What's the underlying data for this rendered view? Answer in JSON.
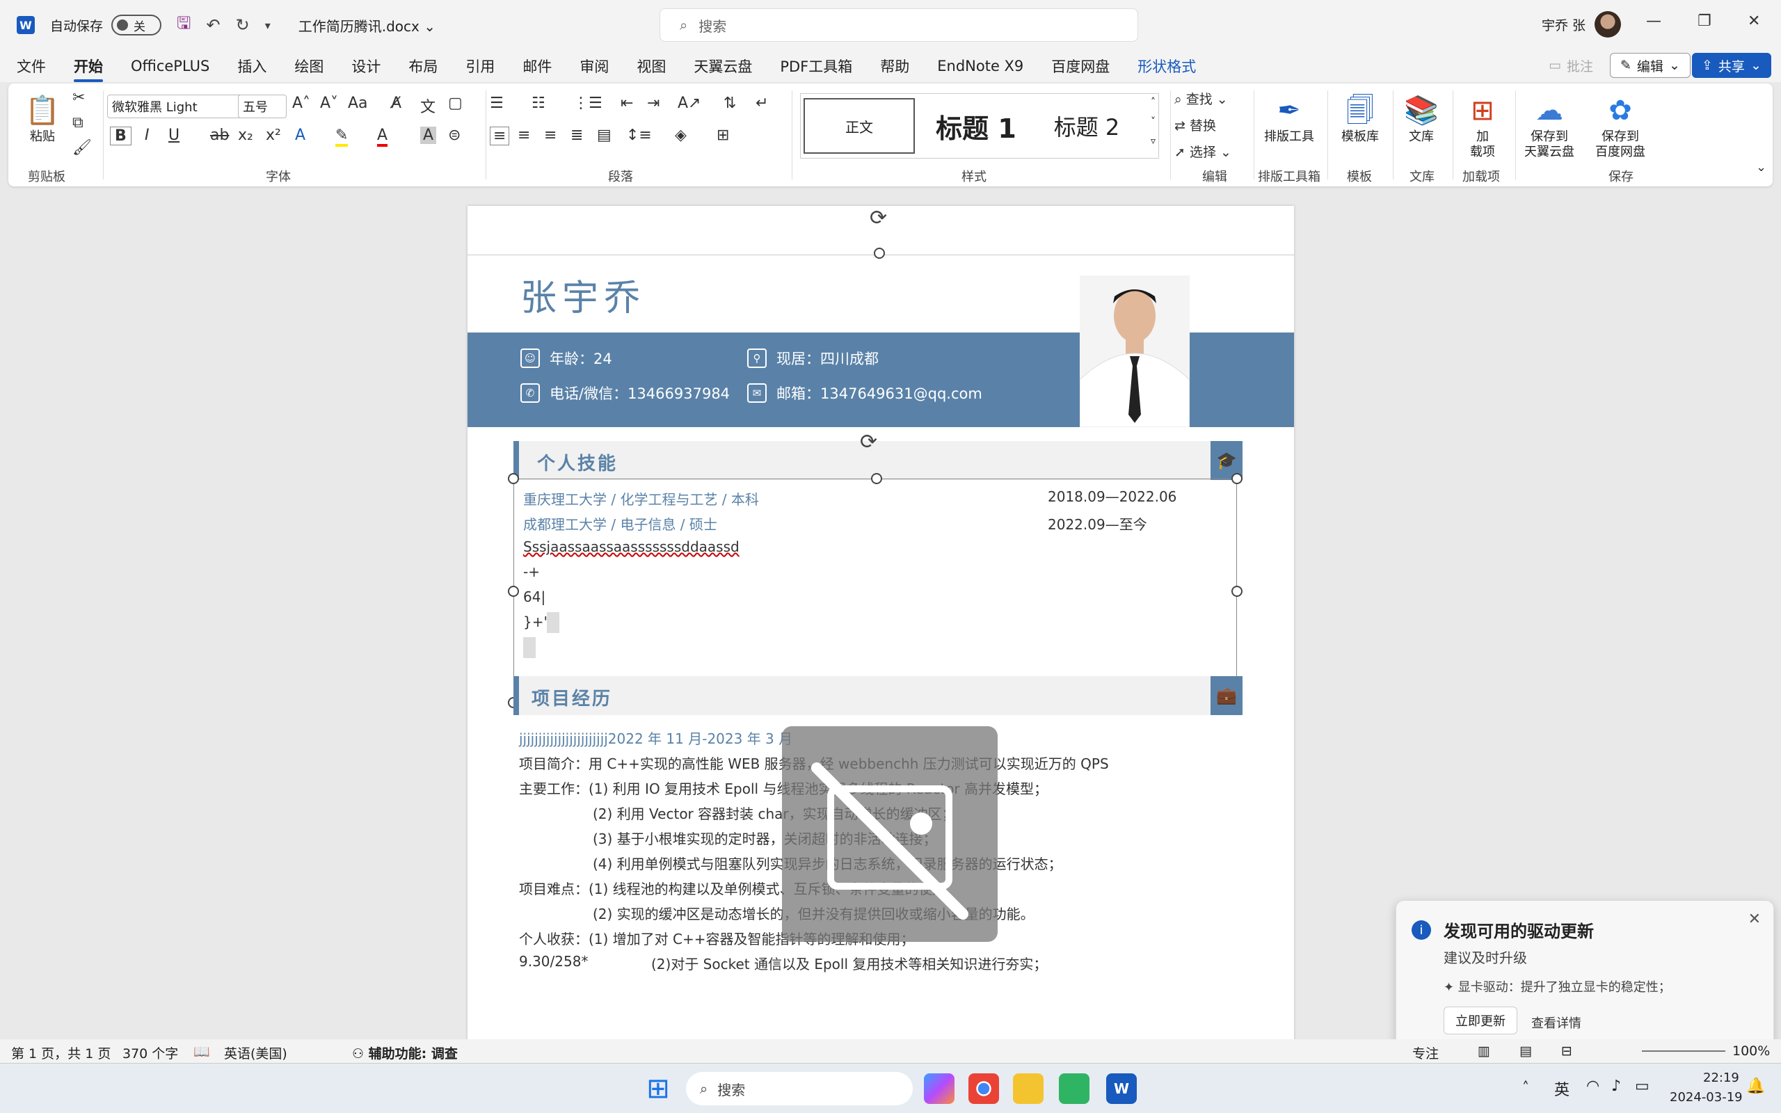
{
  "titlebar": {
    "autosave_label": "自动保存",
    "toggle_state": "关",
    "doc_title": "工作简历腾讯.docx",
    "search_placeholder": "搜索",
    "user_name": "宇乔 张"
  },
  "menu": {
    "items": [
      "文件",
      "开始",
      "OfficePLUS",
      "插入",
      "绘图",
      "设计",
      "布局",
      "引用",
      "邮件",
      "审阅",
      "视图",
      "天翼云盘",
      "PDF工具箱",
      "帮助",
      "EndNote X9",
      "百度网盘",
      "形状格式"
    ],
    "comment_label": "批注",
    "edit_label": "编辑",
    "share_label": "共享"
  },
  "ribbon": {
    "paste_label": "粘贴",
    "clipboard_label": "剪贴板",
    "font_label": "字体",
    "paragraph_label": "段落",
    "styles_label": "样式",
    "editing_label": "编辑",
    "layout_tools_group": "排版工具箱",
    "template_group": "模板",
    "library_group": "文库",
    "addins_group": "加载项",
    "save_group": "保存",
    "font_name": "微软雅黑 Light",
    "font_size": "五号",
    "style_normal": "正文",
    "style_h1": "标题 1",
    "style_h2": "标题 2",
    "find_label": "查找",
    "replace_label": "替换",
    "select_label": "选择",
    "layout_tool_btn": "排版工具",
    "template_lib_btn": "模板库",
    "library_btn": "文库",
    "addin_btn": "加\n载项",
    "save_tianyi_btn": "保存到\n天翼云盘",
    "save_baidu_btn": "保存到\n百度网盘"
  },
  "resume": {
    "name": "张宇乔",
    "age": "年龄：24",
    "location": "现居：四川成都",
    "phone": "电话/微信：13466937984",
    "email": "邮箱：1347649631@qq.com",
    "skills_title": "个人技能",
    "edu1_school": "重庆理工大学 /    化学工程与工艺    /    本科",
    "edu1_date": "2018.09—2022.06",
    "edu2_school": "成都理工大学 /           电子信息       /    硕士",
    "edu2_date": "2022.09—至今",
    "line3": "Sssjaassaassaasssssssddaassd",
    "line4": "-+",
    "line5": "64|",
    "line6": "}+\"",
    "project_title": "项目经历",
    "p_line1": "jjjjjjjjjjjjjjjjjjjjjjj2022 年 11 月-2023 年 3 月",
    "p_line2": "项目简介：用 C++实现的高性能 WEB 服务器，经 webbenchh 压力测试可以实现近万的 QPS",
    "p_line3": "主要工作：(1) 利用 IO 复用技术 Epoll 与线程池实现多线程的 Reactor 高并发模型；",
    "p_line4": "(2) 利用 Vector 容器封装 char，实现自动增长的缓冲区；",
    "p_line5": "(3) 基于小根堆实现的定时器，关闭超时的非活动连接；",
    "p_line6": "(4) 利用单例模式与阻塞队列实现异步的日志系统，记录服务器的运行状态；",
    "p_line7": "项目难点：(1)  线程池的构建以及单例模式、互斥锁、条件变量的使用",
    "p_line8": "(2) 实现的缓冲区是动态增长的，但并没有提供回收或缩小容量的功能。",
    "p_line9": "个人收获：(1) 增加了对 C++容器及智能指针等的理解和使用；",
    "p_line10_a": "9.30/258*",
    "p_line10_b": "(2)对于 Socket 通信以及 Epoll 复用技术等相关知识进行夯实；"
  },
  "toast": {
    "title": "发现可用的驱动更新",
    "subtitle": "建议及时升级",
    "detail": "✦ 显卡驱动：提升了独立显卡的稳定性；",
    "update_btn": "立即更新",
    "details_btn": "查看详情"
  },
  "status": {
    "page": "第 1 页，共 1 页",
    "words": "370 个字",
    "language": "英语(美国)",
    "accessibility": "辅助功能: 调查",
    "focus": "专注",
    "zoom": "100%"
  },
  "taskbar": {
    "search_label": "搜索",
    "ime": "英",
    "time": "22:19",
    "date": "2024-03-19"
  },
  "colors": {
    "accent": "#5a82a8",
    "word_blue": "#185abd"
  }
}
